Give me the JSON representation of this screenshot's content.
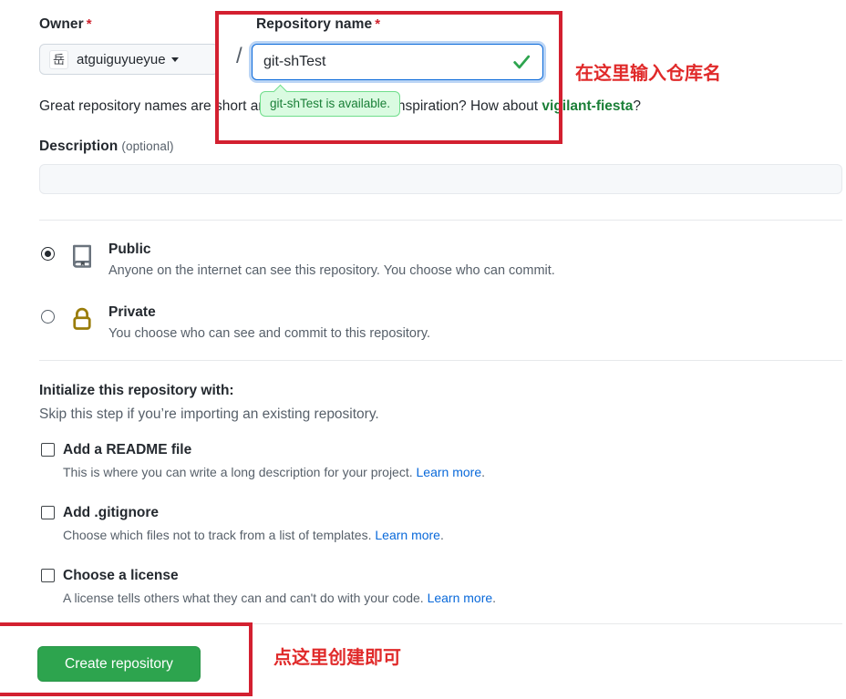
{
  "owner": {
    "label": "Owner",
    "required_mark": "*",
    "avatar_glyph": "岳",
    "name": "atguiguyueyue",
    "separator": "/"
  },
  "repo_name": {
    "label": "Repository name",
    "required_mark": "*",
    "value": "git-shTest",
    "status_icon": "check-icon",
    "availability_tooltip": "git-shTest is available."
  },
  "hint": {
    "prefix": "Great repository names are short and memorable. Need inspiration? How about ",
    "suggestion": "vigilant-fiesta",
    "suffix": "?"
  },
  "description": {
    "label": "Description",
    "optional": "(optional)",
    "value": "",
    "placeholder": ""
  },
  "visibility": {
    "options": [
      {
        "id": "public",
        "icon": "repo-book-icon",
        "title": "Public",
        "description": "Anyone on the internet can see this repository. You choose who can commit.",
        "selected": true
      },
      {
        "id": "private",
        "icon": "lock-icon",
        "title": "Private",
        "description": "You choose who can see and commit to this repository.",
        "selected": false
      }
    ]
  },
  "initialize": {
    "heading": "Initialize this repository with:",
    "subheading": "Skip this step if you’re importing an existing repository.",
    "options": [
      {
        "id": "readme",
        "title": "Add a README file",
        "description": "This is where you can write a long description for your project. ",
        "link_text": "Learn more",
        "link_suffix": ".",
        "checked": false
      },
      {
        "id": "gitignore",
        "title": "Add .gitignore",
        "description": "Choose which files not to track from a list of templates. ",
        "link_text": "Learn more",
        "link_suffix": ".",
        "checked": false
      },
      {
        "id": "license",
        "title": "Choose a license",
        "description": "A license tells others what they can and can't do with your code. ",
        "link_text": "Learn more",
        "link_suffix": ".",
        "checked": false
      }
    ]
  },
  "submit": {
    "label": "Create repository"
  },
  "annotations": [
    {
      "id": "repo-name-annotation",
      "text": "在这里输入仓库名"
    },
    {
      "id": "create-annotation",
      "text": "点这里创建即可"
    }
  ],
  "colors": {
    "accent_green": "#2da44e",
    "link_blue": "#0969da",
    "annotation_red": "#e02a2a",
    "highlight_border": "#d32030",
    "required_red": "#cf222e",
    "lock_gold": "#9a7d0a",
    "tooltip_bg": "#dafbe1",
    "tooltip_border": "#6fdd8b",
    "tooltip_text": "#1a7f37"
  }
}
